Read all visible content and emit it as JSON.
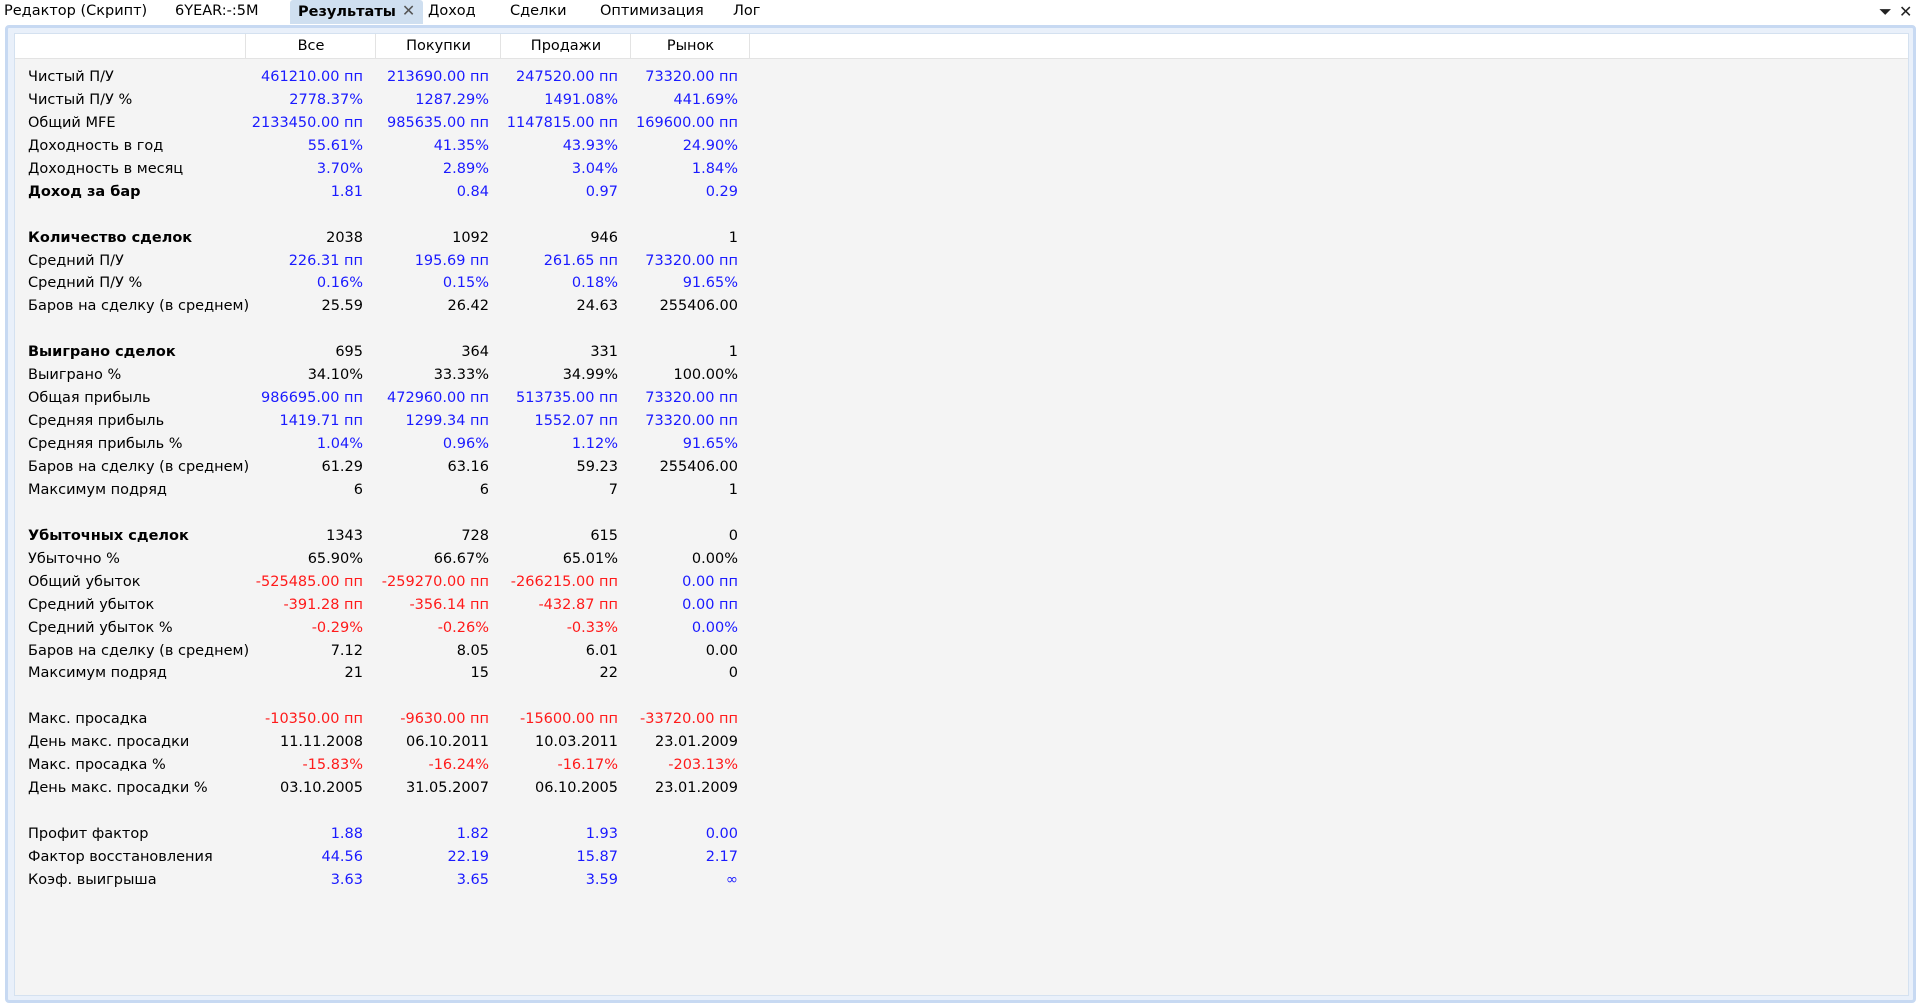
{
  "tabs": [
    {
      "label": "Редактор (Скрипт)",
      "active": false
    },
    {
      "label": "6YEAR:-:5M",
      "active": false
    },
    {
      "label": "Результаты",
      "active": true,
      "close": "✕"
    },
    {
      "label": "Доход",
      "active": false
    },
    {
      "label": "Сделки",
      "active": false
    },
    {
      "label": "Оптимизация",
      "active": false
    },
    {
      "label": "Лог",
      "active": false
    }
  ],
  "window_buttons": {
    "menu": "⏷",
    "close": "✕"
  },
  "colors": {
    "pos": "#1a1aff",
    "neg": "#ff1a1a",
    "plain": "#000000"
  },
  "table": {
    "columns": [
      "Все",
      "Покупки",
      "Продажи",
      "Рынок"
    ],
    "rows": [
      {
        "label": "Чистый П/У",
        "tone": "pos",
        "values": [
          "461210.00 пп",
          "213690.00 пп",
          "247520.00 пп",
          "73320.00 пп"
        ]
      },
      {
        "label": "Чистый П/У %",
        "tone": "pos",
        "values": [
          "2778.37%",
          "1287.29%",
          "1491.08%",
          "441.69%"
        ]
      },
      {
        "label": "Общий MFE",
        "tone": "pos",
        "values": [
          "2133450.00 пп",
          "985635.00 пп",
          "1147815.00 пп",
          "169600.00 пп"
        ]
      },
      {
        "label": "Доходность в год",
        "tone": "pos",
        "values": [
          "55.61%",
          "41.35%",
          "43.93%",
          "24.90%"
        ]
      },
      {
        "label": "Доходность в месяц",
        "tone": "pos",
        "values": [
          "3.70%",
          "2.89%",
          "3.04%",
          "1.84%"
        ]
      },
      {
        "label": "Доход за бар",
        "bold": true,
        "tone": "pos",
        "values": [
          "1.81",
          "0.84",
          "0.97",
          "0.29"
        ]
      },
      null,
      {
        "label": "Количество сделок",
        "bold": true,
        "tone": "plain",
        "values": [
          "2038",
          "1092",
          "946",
          "1"
        ]
      },
      {
        "label": "Средний П/У",
        "tone": "pos",
        "values": [
          "226.31 пп",
          "195.69 пп",
          "261.65 пп",
          "73320.00 пп"
        ]
      },
      {
        "label": "Средний П/У %",
        "tone": "pos",
        "values": [
          "0.16%",
          "0.15%",
          "0.18%",
          "91.65%"
        ]
      },
      {
        "label": "Баров на сделку (в среднем)",
        "tone": "plain",
        "values": [
          "25.59",
          "26.42",
          "24.63",
          "255406.00"
        ]
      },
      null,
      {
        "label": "Выиграно сделок",
        "bold": true,
        "tone": "plain",
        "values": [
          "695",
          "364",
          "331",
          "1"
        ]
      },
      {
        "label": "Выиграно %",
        "tone": "plain",
        "values": [
          "34.10%",
          "33.33%",
          "34.99%",
          "100.00%"
        ]
      },
      {
        "label": "Общая прибыль",
        "tone": "pos",
        "values": [
          "986695.00 пп",
          "472960.00 пп",
          "513735.00 пп",
          "73320.00 пп"
        ]
      },
      {
        "label": "Средняя прибыль",
        "tone": "pos",
        "values": [
          "1419.71 пп",
          "1299.34 пп",
          "1552.07 пп",
          "73320.00 пп"
        ]
      },
      {
        "label": "Средняя прибыль %",
        "tone": "pos",
        "values": [
          "1.04%",
          "0.96%",
          "1.12%",
          "91.65%"
        ]
      },
      {
        "label": "Баров на сделку (в среднем)",
        "tone": "plain",
        "values": [
          "61.29",
          "63.16",
          "59.23",
          "255406.00"
        ]
      },
      {
        "label": "Максимум подряд",
        "tone": "plain",
        "values": [
          "6",
          "6",
          "7",
          "1"
        ]
      },
      null,
      {
        "label": "Убыточных сделок",
        "bold": true,
        "tone": "plain",
        "values": [
          "1343",
          "728",
          "615",
          "0"
        ]
      },
      {
        "label": "Убыточно %",
        "tone": "plain",
        "values": [
          "65.90%",
          "66.67%",
          "65.01%",
          "0.00%"
        ]
      },
      {
        "label": "Общий убыток",
        "tones": [
          "neg",
          "neg",
          "neg",
          "pos"
        ],
        "values": [
          "-525485.00 пп",
          "-259270.00 пп",
          "-266215.00 пп",
          "0.00 пп"
        ]
      },
      {
        "label": "Средний убыток",
        "tones": [
          "neg",
          "neg",
          "neg",
          "pos"
        ],
        "values": [
          "-391.28 пп",
          "-356.14 пп",
          "-432.87 пп",
          "0.00 пп"
        ]
      },
      {
        "label": "Средний убыток %",
        "tones": [
          "neg",
          "neg",
          "neg",
          "pos"
        ],
        "values": [
          "-0.29%",
          "-0.26%",
          "-0.33%",
          "0.00%"
        ]
      },
      {
        "label": "Баров на сделку (в среднем)",
        "tone": "plain",
        "values": [
          "7.12",
          "8.05",
          "6.01",
          "0.00"
        ]
      },
      {
        "label": "Максимум подряд",
        "tone": "plain",
        "values": [
          "21",
          "15",
          "22",
          "0"
        ]
      },
      null,
      {
        "label": "Макс. просадка",
        "tone": "neg",
        "values": [
          "-10350.00 пп",
          "-9630.00 пп",
          "-15600.00 пп",
          "-33720.00 пп"
        ]
      },
      {
        "label": "День макс. просадки",
        "tone": "plain",
        "values": [
          "11.11.2008",
          "06.10.2011",
          "10.03.2011",
          "23.01.2009"
        ]
      },
      {
        "label": "Макс. просадка %",
        "tone": "neg",
        "values": [
          "-15.83%",
          "-16.24%",
          "-16.17%",
          "-203.13%"
        ]
      },
      {
        "label": "День макс. просадки %",
        "tone": "plain",
        "values": [
          "03.10.2005",
          "31.05.2007",
          "06.10.2005",
          "23.01.2009"
        ]
      },
      null,
      {
        "label": "Профит фактор",
        "tone": "pos",
        "values": [
          "1.88",
          "1.82",
          "1.93",
          "0.00"
        ]
      },
      {
        "label": "Фактор восстановления",
        "tone": "pos",
        "values": [
          "44.56",
          "22.19",
          "15.87",
          "2.17"
        ]
      },
      {
        "label": "Коэф. выигрыша",
        "tone": "pos",
        "values": [
          "3.63",
          "3.65",
          "3.59",
          "∞"
        ]
      }
    ]
  }
}
